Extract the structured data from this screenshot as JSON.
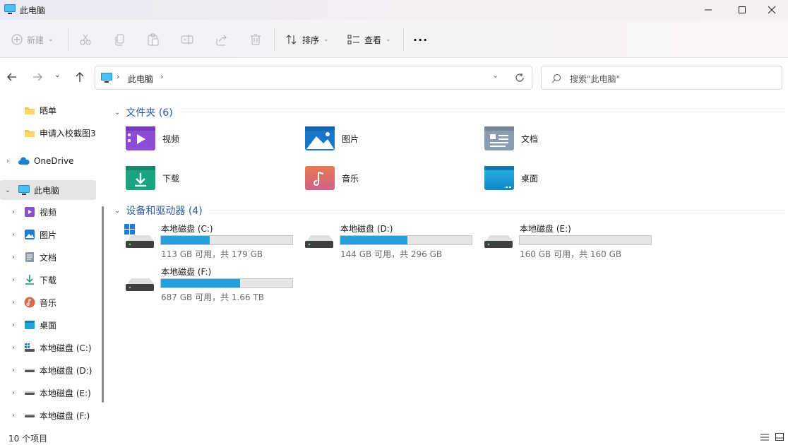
{
  "window": {
    "title": "此电脑",
    "icon": "computer-icon"
  },
  "toolbar": {
    "new_label": "新建",
    "sort_label": "排序",
    "view_label": "查看",
    "more_label": "···"
  },
  "address": {
    "crumb": "此电脑",
    "search_placeholder": "搜索\"此电脑\""
  },
  "sidebar": {
    "items": [
      {
        "label": "晒单",
        "icon": "folder-icon"
      },
      {
        "label": "申请入校截图3",
        "icon": "folder-icon"
      },
      {
        "label": "OneDrive",
        "icon": "cloud-icon"
      },
      {
        "label": "此电脑",
        "icon": "computer-icon"
      },
      {
        "label": "视频",
        "icon": "video-icon"
      },
      {
        "label": "图片",
        "icon": "picture-icon"
      },
      {
        "label": "文档",
        "icon": "document-icon"
      },
      {
        "label": "下载",
        "icon": "download-icon"
      },
      {
        "label": "音乐",
        "icon": "music-icon"
      },
      {
        "label": "桌面",
        "icon": "desktop-icon"
      },
      {
        "label": "本地磁盘 (C:)",
        "icon": "drive-icon"
      },
      {
        "label": "本地磁盘 (D:)",
        "icon": "drive-icon"
      },
      {
        "label": "本地磁盘 (E:)",
        "icon": "drive-icon"
      },
      {
        "label": "本地磁盘 (F:)",
        "icon": "drive-icon"
      }
    ]
  },
  "content": {
    "folders_header": "文件夹 (6)",
    "folders": [
      {
        "label": "视频",
        "icon": "video-folder-icon"
      },
      {
        "label": "图片",
        "icon": "picture-folder-icon"
      },
      {
        "label": "文档",
        "icon": "document-folder-icon"
      },
      {
        "label": "下载",
        "icon": "download-folder-icon"
      },
      {
        "label": "音乐",
        "icon": "music-folder-icon"
      },
      {
        "label": "桌面",
        "icon": "desktop-folder-icon"
      }
    ],
    "drives_header": "设备和驱动器 (4)",
    "drives": [
      {
        "label": "本地磁盘 (C:)",
        "usage": "113 GB 可用，共 179 GB",
        "used_fraction": 0.37
      },
      {
        "label": "本地磁盘 (D:)",
        "usage": "144 GB 可用，共 296 GB",
        "used_fraction": 0.51
      },
      {
        "label": "本地磁盘 (E:)",
        "usage": "160 GB 可用，共 160 GB",
        "used_fraction": 0.0
      },
      {
        "label": "本地磁盘 (F:)",
        "usage": "687 GB 可用，共 1.66 TB",
        "used_fraction": 0.6
      }
    ]
  },
  "status": {
    "count": "10 个项目"
  },
  "colors": {
    "accent": "#26a0da",
    "group_header": "#2b5aa0"
  }
}
